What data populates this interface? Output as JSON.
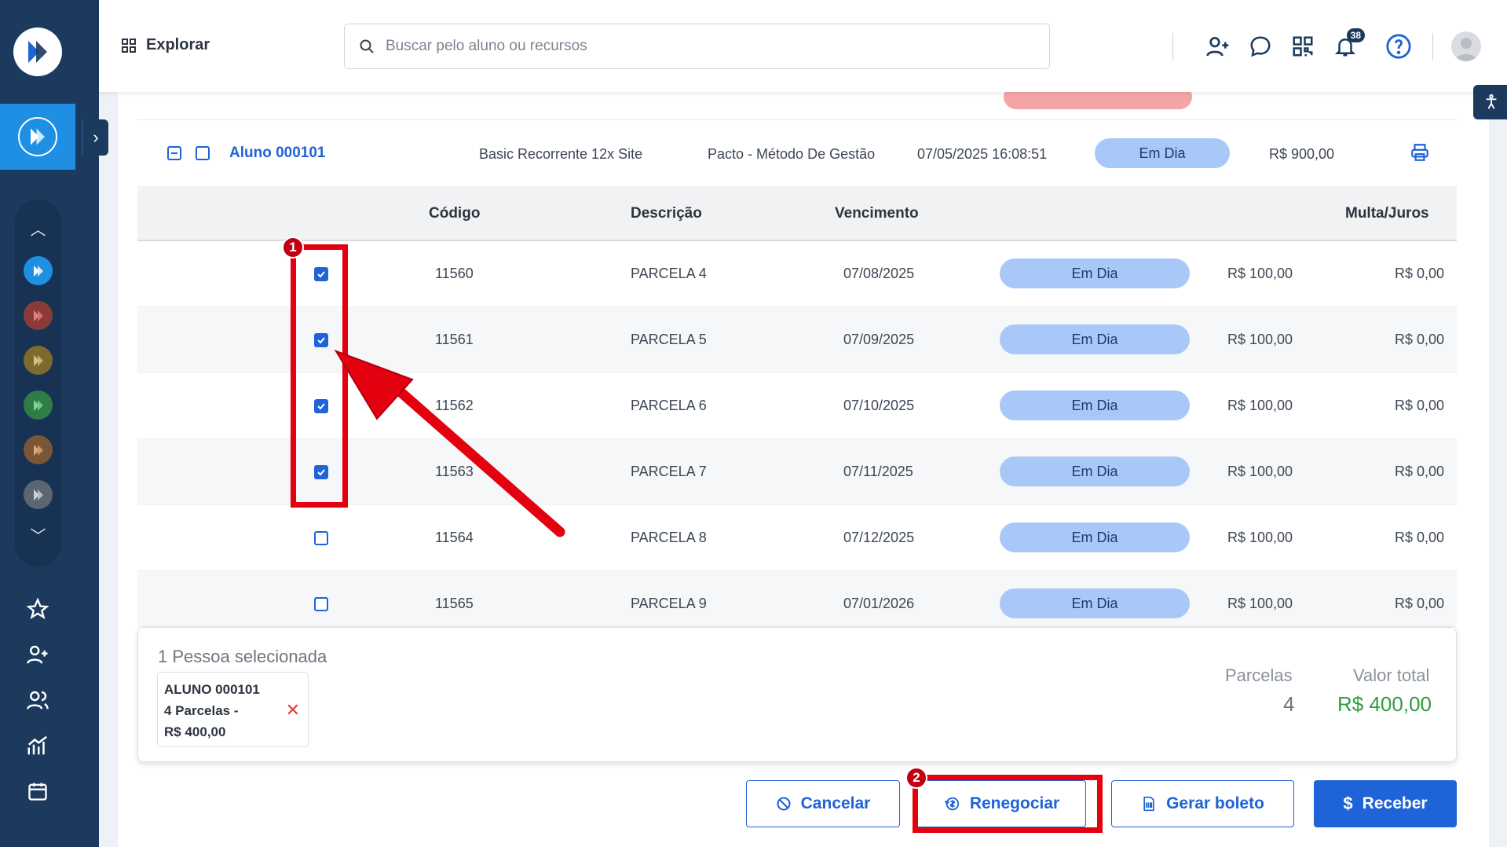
{
  "header": {
    "explorar_label": "Explorar",
    "search_placeholder": "Buscar pelo aluno ou recursos",
    "notifications_count": "38"
  },
  "student": {
    "name": "Aluno 000101",
    "plan": "Basic Recorrente 12x Site",
    "company": "Pacto - Método De Gestão",
    "datetime": "07/05/2025 16:08:51",
    "status": "Em Dia",
    "value": "R$ 900,00"
  },
  "table": {
    "headers": {
      "codigo": "Código",
      "descricao": "Descrição",
      "vencimento": "Vencimento",
      "multa": "Multa/Juros"
    },
    "rows": [
      {
        "checked": true,
        "codigo": "11560",
        "descricao": "PARCELA 4",
        "vencimento": "07/08/2025",
        "status": "Em Dia",
        "valor": "R$ 100,00",
        "multa": "R$ 0,00"
      },
      {
        "checked": true,
        "codigo": "11561",
        "descricao": "PARCELA 5",
        "vencimento": "07/09/2025",
        "status": "Em Dia",
        "valor": "R$ 100,00",
        "multa": "R$ 0,00"
      },
      {
        "checked": true,
        "codigo": "11562",
        "descricao": "PARCELA 6",
        "vencimento": "07/10/2025",
        "status": "Em Dia",
        "valor": "R$ 100,00",
        "multa": "R$ 0,00"
      },
      {
        "checked": true,
        "codigo": "11563",
        "descricao": "PARCELA 7",
        "vencimento": "07/11/2025",
        "status": "Em Dia",
        "valor": "R$ 100,00",
        "multa": "R$ 0,00"
      },
      {
        "checked": false,
        "codigo": "11564",
        "descricao": "PARCELA 8",
        "vencimento": "07/12/2025",
        "status": "Em Dia",
        "valor": "R$ 100,00",
        "multa": "R$ 0,00"
      },
      {
        "checked": false,
        "codigo": "11565",
        "descricao": "PARCELA 9",
        "vencimento": "07/01/2026",
        "status": "Em Dia",
        "valor": "R$ 100,00",
        "multa": "R$ 0,00"
      }
    ]
  },
  "selection": {
    "title": "1 Pessoa selecionada",
    "chip_line1": "ALUNO 000101",
    "chip_line2": "4 Parcelas -",
    "chip_line3": "R$ 400,00",
    "parcelas_label": "Parcelas",
    "parcelas_value": "4",
    "total_label": "Valor total",
    "total_value": "R$ 400,00"
  },
  "actions": {
    "cancelar": "Cancelar",
    "renegociar": "Renegociar",
    "gerar_boleto": "Gerar boleto",
    "receber": "Receber"
  },
  "annotations": {
    "step1": "1",
    "step2": "2"
  },
  "colors": {
    "primary": "#1e63d8",
    "sidebar": "#1b3a5e",
    "status_pill": "#a8c8f7",
    "annotation_red": "#e3000f",
    "total_green": "#2e9e3e"
  }
}
